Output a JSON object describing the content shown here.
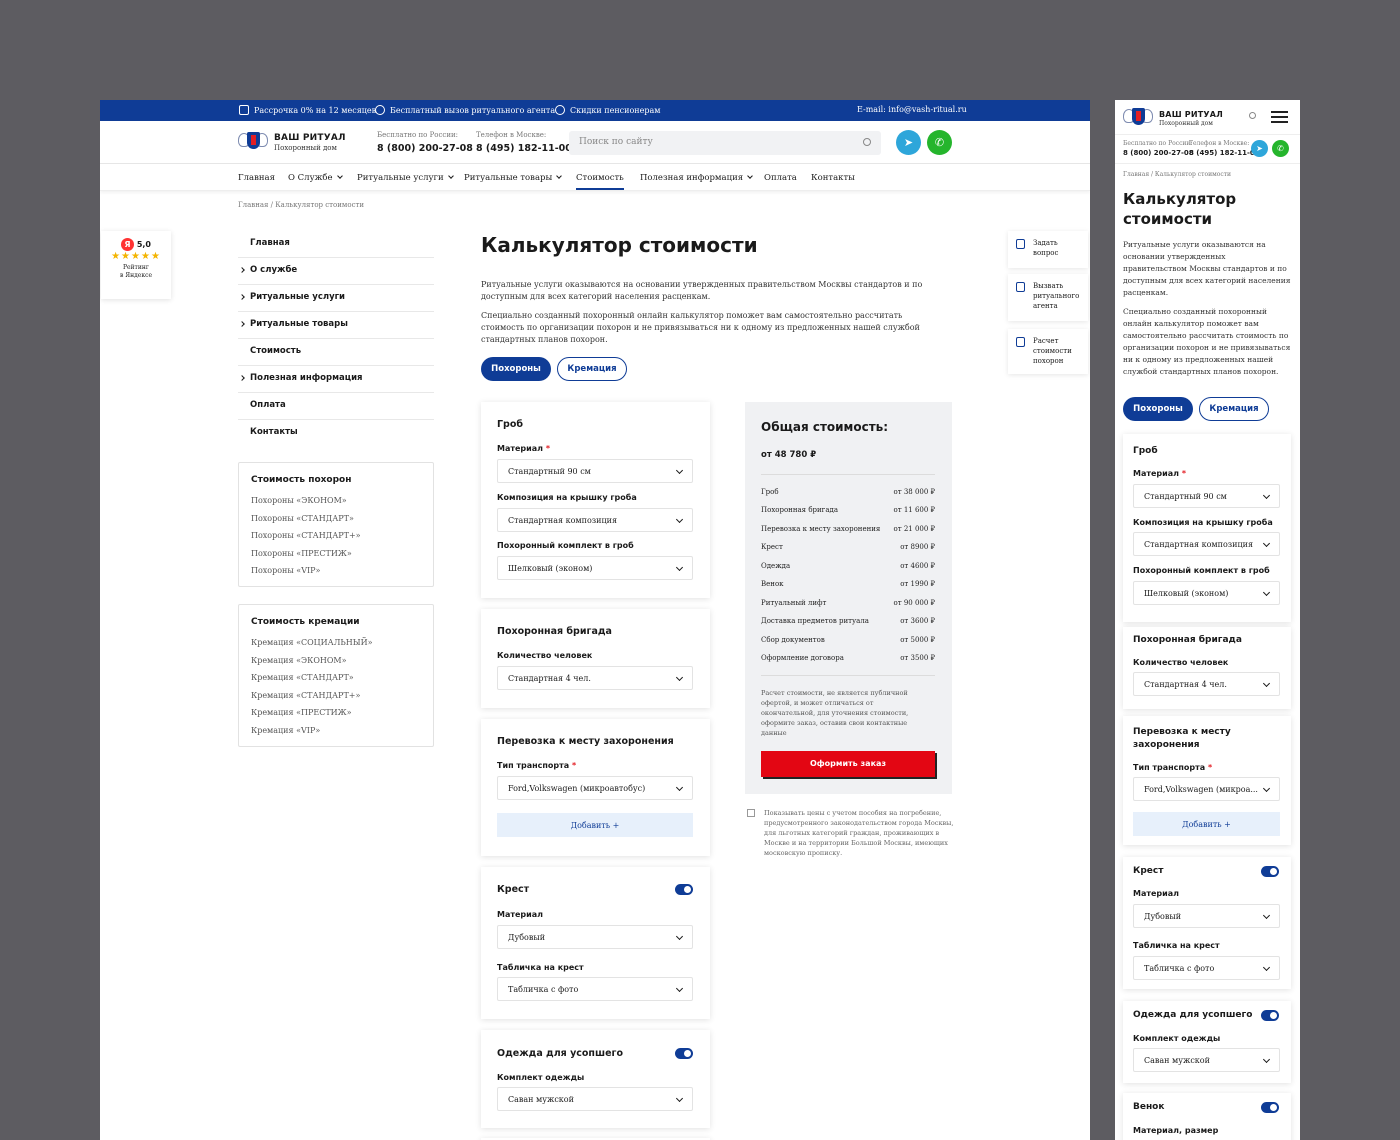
{
  "topbar": {
    "items": [
      "Рассрочка 0% на 12 месяцев",
      "Бесплатный вызов ритуального агента",
      "Скидки пенсионерам"
    ],
    "email": "E-mail: info@vash-ritual.ru"
  },
  "brand": {
    "name": "ВАШ РИТУАЛ",
    "tagline": "Похоронный дом"
  },
  "phones": [
    {
      "label": "Бесплатно по России:",
      "number": "8 (800) 200-27-08"
    },
    {
      "label": "Телефон в Москве:",
      "number": "8 (495) 182-11-00"
    }
  ],
  "search": {
    "placeholder": "Поиск по сайту"
  },
  "nav": [
    "Главная",
    "О Службе",
    "Ритуальные услуги",
    "Ритуальные товары",
    "Стоимость",
    "Полезная информация",
    "Оплата",
    "Контакты"
  ],
  "breadcrumb": "Главная / Калькулятор стоимости",
  "rating": {
    "score": "5,0",
    "label1": "Рейтинг",
    "label2": "в Яндексе",
    "stars": "★★★★★",
    "ya": "Я"
  },
  "side_menu": [
    "Главная",
    "О службе",
    "Ритуальные услуги",
    "Ритуальные товары",
    "Стоимость",
    "Полезная информация",
    "Оплата",
    "Контакты"
  ],
  "funeral_box": {
    "title": "Стоимость похорон",
    "items": [
      "Похороны «ЭКОНОМ»",
      "Похороны «СТАНДАРТ»",
      "Похороны «СТАНДАРТ+»",
      "Похороны «ПРЕСТИЖ»",
      "Похороны «VIP»"
    ]
  },
  "cremation_box": {
    "title": "Стоимость кремации",
    "items": [
      "Кремация «СОЦИАЛЬНЫЙ»",
      "Кремация «ЭКОНОМ»",
      "Кремация «СТАНДАРТ»",
      "Кремация «СТАНДАРТ+»",
      "Кремация «ПРЕСТИЖ»",
      "Кремация «VIP»"
    ]
  },
  "page": {
    "title": "Калькулятор стоимости",
    "p1": "Ритуальные услуги оказываются на основании утвержденных правительством Москвы стандартов и по доступным для всех категорий населения расценкам.",
    "p2": "Специально созданный похоронный онлайн калькулятор поможет вам самостоятельно рассчитать стоимость по организации похорон и не привязываться ни к одному из предложенных нашей службой стандартных планов похорон.",
    "tab_funeral": "Похороны",
    "tab_cremation": "Кремация"
  },
  "coffin": {
    "title": "Гроб",
    "material_label": "Материал",
    "material": "Стандартный 90 см",
    "lid_label": "Композиция на крышку гроба",
    "lid": "Стандартная композиция",
    "set_label": "Похоронный комплект в гроб",
    "set": "Шелковый (эконом)"
  },
  "brigade": {
    "title": "Похоронная бригада",
    "count_label": "Количество человек",
    "count": "Стандартная 4 чел."
  },
  "transport": {
    "title": "Перевозка к месту захоронения",
    "title_m1": "Перевозка к месту",
    "title_m2": "захоронения",
    "type_label": "Тип транспорта",
    "type": "Ford,Volkswagen (микроавтобус)",
    "add": "Добавить  +"
  },
  "cross": {
    "title": "Крест",
    "material_label": "Материал",
    "material": "Дубовый",
    "plate_label": "Табличка на крест",
    "plate": "Табличка с фото"
  },
  "clothes": {
    "title": "Одежда для усопшего",
    "set_label": "Комплект одежды",
    "set": "Саван мужской"
  },
  "wreath": {
    "title": "Венок",
    "label": "Материал, размер"
  },
  "required_mark": "*",
  "total": {
    "title": "Общая стоимость:",
    "value": "от 48 780 ₽",
    "lines": [
      {
        "name": "Гроб",
        "price": "от 38 000 ₽"
      },
      {
        "name": "Похоронная бригада",
        "price": "от 11 600 ₽"
      },
      {
        "name": "Перевозка к месту захоронения",
        "price": "от 21 000 ₽"
      },
      {
        "name": "Крест",
        "price": "от 8900 ₽"
      },
      {
        "name": "Одежда",
        "price": "от 4600 ₽"
      },
      {
        "name": "Венок",
        "price": "от 1990 ₽"
      },
      {
        "name": "Ритуальный лифт",
        "price": "от 90 000 ₽"
      },
      {
        "name": "Доставка предметов ритуала",
        "price": "от 3600 ₽"
      },
      {
        "name": "Сбор документов",
        "price": "от 5000 ₽"
      },
      {
        "name": "Оформление договора",
        "price": "от 3500 ₽"
      }
    ],
    "note": "Расчет стоимости, не является публичной офертой, и может отличаться от окончательной, для уточнения стоимости, оформите заказ, оставив свои контактные данные",
    "order": "Оформить заказ",
    "checkbox": "Показывать цены с учетом пособия на погребение, предусмотренного законодательством города Москвы, для льготных категорий граждан, проживающих в Москве и на территории Большой Москвы, имеющих московскую прописку."
  },
  "right_side": [
    {
      "l1": "Задать",
      "l2": "вопрос",
      "l3": ""
    },
    {
      "l1": "Вызвать",
      "l2": "ритуального",
      "l3": "агента"
    },
    {
      "l1": "Расчет",
      "l2": "стоимости",
      "l3": "похорон"
    }
  ],
  "mobile": {
    "title_l1": "Калькулятор",
    "title_l2": "стоимости",
    "transport_value": "Ford,Volkswagen (микроа...",
    "add": "Добавить  +"
  },
  "colors": {
    "brand_blue": "#0f3c96",
    "order_red": "#e30613",
    "telegram": "#2ea6da",
    "whatsapp": "#25b52c"
  },
  "icons": {
    "telegram": "telegram-icon",
    "whatsapp": "whatsapp-icon",
    "search": "search-icon",
    "menu": "hamburger-menu-icon"
  }
}
